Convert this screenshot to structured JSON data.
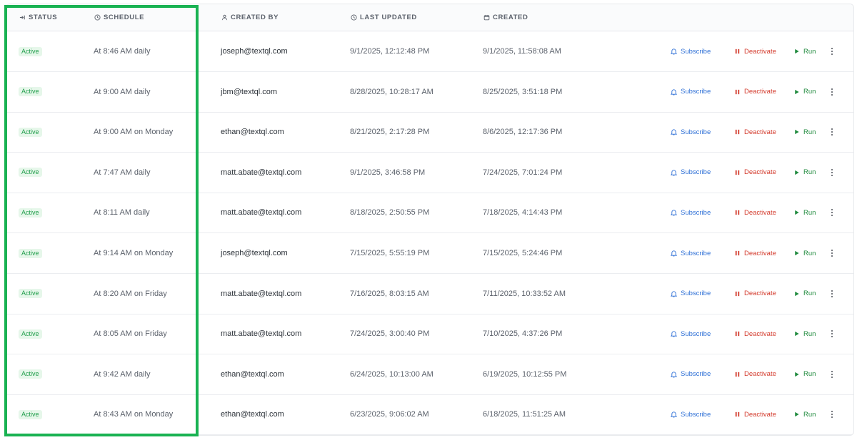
{
  "colors": {
    "highlight": "#19b252",
    "active_badge_bg": "#e6f7ea",
    "active_badge_text": "#1f9d4a",
    "subscribe": "#2d6fd6",
    "deactivate": "#d33a2c",
    "run": "#1f8a3d"
  },
  "columns": {
    "status": "STATUS",
    "schedule": "SCHEDULE",
    "created_by": "CREATED BY",
    "last_updated": "LAST UPDATED",
    "created": "CREATED"
  },
  "icons": {
    "status": "sort-icon",
    "schedule": "clock-icon",
    "created_by": "user-icon",
    "last_updated": "clock-icon",
    "created": "calendar-icon",
    "subscribe": "bell-icon",
    "deactivate": "pause-icon",
    "run": "play-icon",
    "more": "more-vertical-icon"
  },
  "actions": {
    "subscribe": "Subscribe",
    "deactivate": "Deactivate",
    "run": "Run"
  },
  "rows": [
    {
      "status": "Active",
      "schedule": "At 8:46 AM daily",
      "created_by": "joseph@textql.com",
      "last_updated": "9/1/2025, 12:12:48 PM",
      "created": "9/1/2025, 11:58:08 AM"
    },
    {
      "status": "Active",
      "schedule": "At 9:00 AM daily",
      "created_by": "jbm@textql.com",
      "last_updated": "8/28/2025, 10:28:17 AM",
      "created": "8/25/2025, 3:51:18 PM"
    },
    {
      "status": "Active",
      "schedule": "At 9:00 AM on Monday",
      "created_by": "ethan@textql.com",
      "last_updated": "8/21/2025, 2:17:28 PM",
      "created": "8/6/2025, 12:17:36 PM"
    },
    {
      "status": "Active",
      "schedule": "At 7:47 AM daily",
      "created_by": "matt.abate@textql.com",
      "last_updated": "9/1/2025, 3:46:58 PM",
      "created": "7/24/2025, 7:01:24 PM"
    },
    {
      "status": "Active",
      "schedule": "At 8:11 AM daily",
      "created_by": "matt.abate@textql.com",
      "last_updated": "8/18/2025, 2:50:55 PM",
      "created": "7/18/2025, 4:14:43 PM"
    },
    {
      "status": "Active",
      "schedule": "At 9:14 AM on Monday",
      "created_by": "joseph@textql.com",
      "last_updated": "7/15/2025, 5:55:19 PM",
      "created": "7/15/2025, 5:24:46 PM"
    },
    {
      "status": "Active",
      "schedule": "At 8:20 AM on Friday",
      "created_by": "matt.abate@textql.com",
      "last_updated": "7/16/2025, 8:03:15 AM",
      "created": "7/11/2025, 10:33:52 AM"
    },
    {
      "status": "Active",
      "schedule": "At 8:05 AM on Friday",
      "created_by": "matt.abate@textql.com",
      "last_updated": "7/24/2025, 3:00:40 PM",
      "created": "7/10/2025, 4:37:26 PM"
    },
    {
      "status": "Active",
      "schedule": "At 9:42 AM daily",
      "created_by": "ethan@textql.com",
      "last_updated": "6/24/2025, 10:13:00 AM",
      "created": "6/19/2025, 10:12:55 PM"
    },
    {
      "status": "Active",
      "schedule": "At 8:43 AM on Monday",
      "created_by": "ethan@textql.com",
      "last_updated": "6/23/2025, 9:06:02 AM",
      "created": "6/18/2025, 11:51:25 AM"
    }
  ]
}
